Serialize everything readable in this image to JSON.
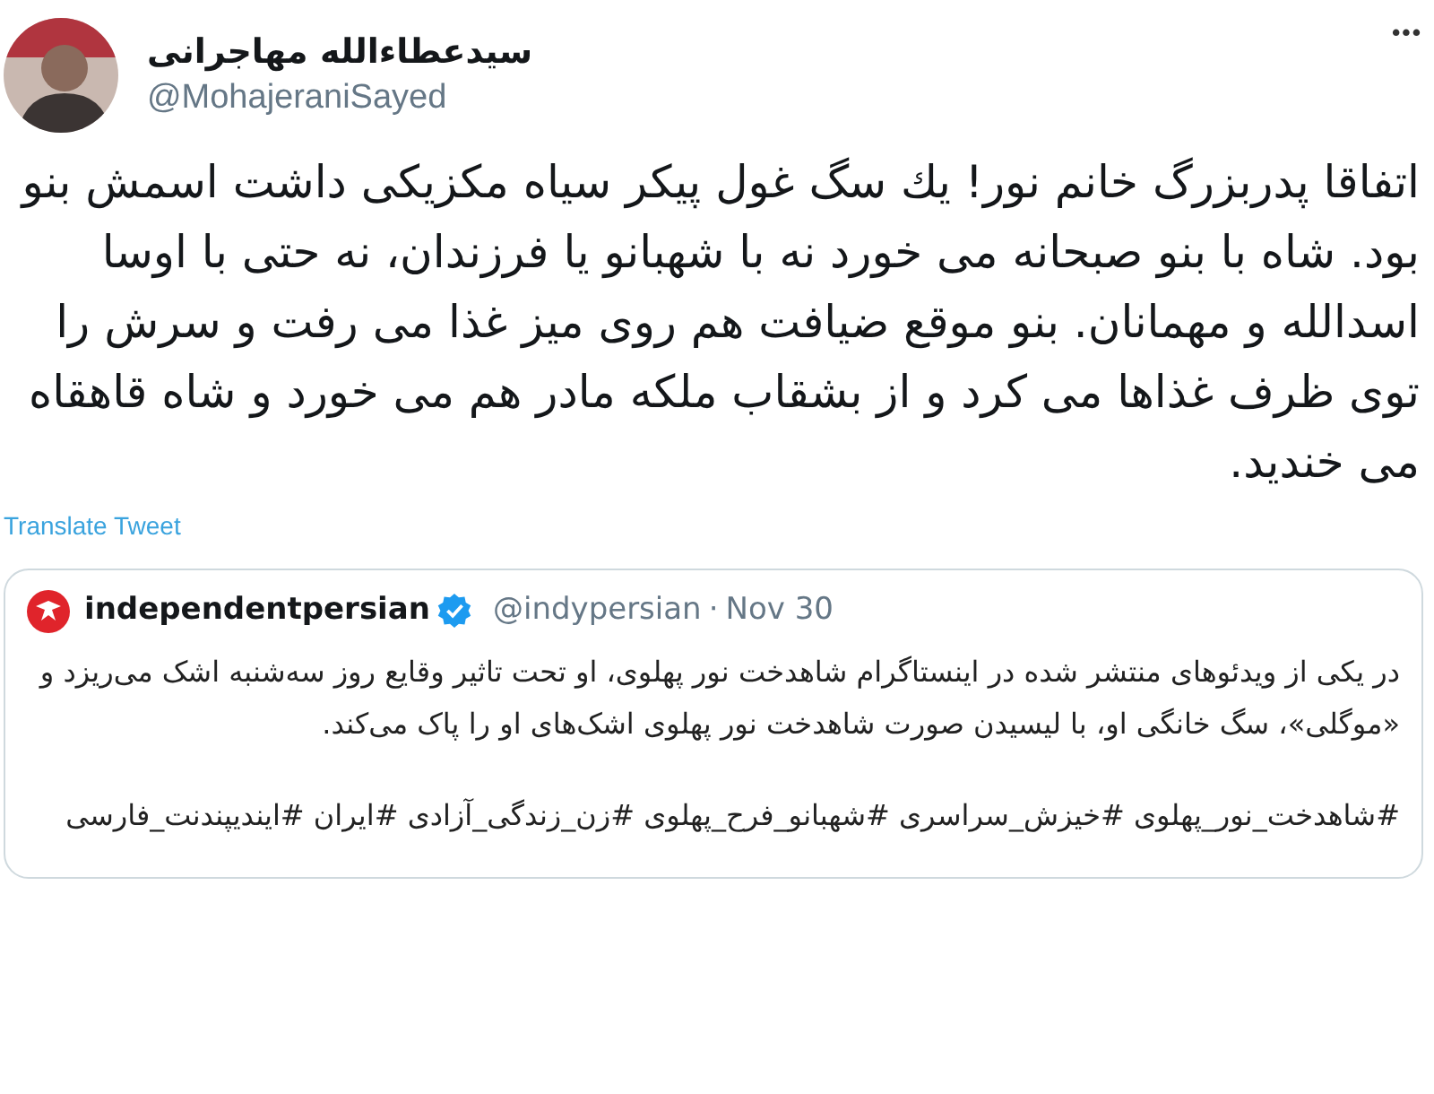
{
  "author": {
    "name": "سیدعطاءالله مهاجرانی",
    "handle": "@MohajeraniSayed"
  },
  "more": "•••",
  "tweet_text": "اتفاقا پدربزرگ خانم نور! یك سگ غول پیكر سیاه مكزیكی داشت اسمش بنو بود.  شاه با بنو صبحانه می خورد نه با شهبانو یا فرزندان، نه حتی با اوسا اسدالله و مهمانان. بنو موقع ضیافت هم روی میز غذا می رفت و سرش را توی ظرف غذاها می كرد و از بشقاب ملكه مادر هم می خورد و شاه قاهقاه می خندید.",
  "translate_link": "Translate Tweet",
  "quoted": {
    "name": "independentpersian",
    "verified": true,
    "handle": "@indypersian",
    "separator": "·",
    "date": "Nov 30",
    "text": "در یکی از ویدئوهای منتشر شده در اینستاگرام شاهدخت نور پهلوی، او تحت تاثیر وقایع روز سه‌شنبه اشک می‌ریزد و «موگلی»، سگ خانگی او، با لیسیدن صورت شاهدخت نور پهلوی اشک‌های او را پاک می‌کند.",
    "hashtags": "#شاهدخت_نور_پهلوی #خیزش_سراسری #شهبانو_فرح_پهلوی #زن_زندگی_آزادی #ایران #ایندیپندنت_فارسی"
  }
}
